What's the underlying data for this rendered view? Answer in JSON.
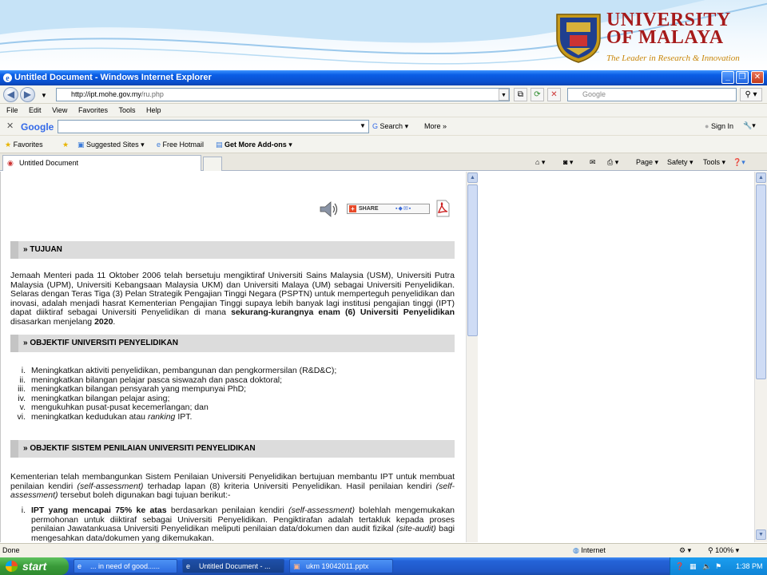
{
  "slide": {
    "logo_line1": "UNIVERSITY",
    "logo_line2": "OF MALAYA",
    "tagline": "The Leader in Research & Innovation"
  },
  "browser": {
    "title": "Untitled Document - Windows Internet Explorer",
    "url_host": "http://ipt.mohe.gov.my",
    "url_path": "/ru.php",
    "search_placeholder": "Google",
    "menu": [
      "File",
      "Edit",
      "View",
      "Favorites",
      "Tools",
      "Help"
    ],
    "google_bar": {
      "logo": "Google",
      "search_label": "Search",
      "more_label": "More »",
      "signin_label": "Sign In"
    },
    "favorites_bar": {
      "favorites": "Favorites",
      "suggested": "Suggested Sites",
      "hotmail": "Free Hotmail",
      "addons": "Get More Add-ons"
    },
    "tab_title": "Untitled Document",
    "command_bar": {
      "page": "Page",
      "safety": "Safety",
      "tools": "Tools"
    },
    "status": {
      "left": "Done",
      "zone": "Internet",
      "zoom": "100%"
    }
  },
  "content": {
    "share_label": "SHARE",
    "sections": {
      "tujuan": "» TUJUAN",
      "objektif_up": "» OBJEKTIF UNIVERSITI PENYELIDIKAN",
      "objektif_sistem": "» OBJEKTIF SISTEM PENILAIAN UNIVERSITI PENYELIDIKAN"
    },
    "tujuan_para_a": "Jemaah Menteri pada 11 Oktober 2006 telah bersetuju mengiktiraf Universiti Sains Malaysia (USM), Universiti Putra Malaysia (UPM), Universiti Kebangsaan Malaysia UKM) dan Universiti Malaya (UM) sebagai Universiti Penyelidikan. Selaras dengan Teras Tiga (3) Pelan Strategik Pengajian Tinggi Negara (PSPTN) untuk memperteguh penyelidikan dan inovasi, adalah menjadi hasrat Kementerian Pengajian Tinggi supaya lebih banyak lagi institusi pengajian tinggi (IPT) dapat diiktiraf sebagai Universiti Penyelidikan di mana ",
    "tujuan_bold_a": "sekurang-kurangnya enam (6) Universiti Penyelidikan",
    "tujuan_para_b": " disasarkan menjelang ",
    "tujuan_bold_b": "2020",
    "tujuan_end": ".",
    "objektif_list": [
      {
        "num": "i.",
        "text": "Meningkatkan aktiviti penyelidikan, pembangunan dan pengkormersilan (R&D&C);"
      },
      {
        "num": "ii.",
        "text": "meningkatkan bilangan pelajar pasca siswazah dan pasca doktoral;"
      },
      {
        "num": "iii.",
        "text": "meningkatkan bilangan pensyarah yang mempunyai PhD;"
      },
      {
        "num": "iv.",
        "text": "meningkatkan bilangan pelajar asing;"
      },
      {
        "num": "v.",
        "text": "mengukuhkan pusat-pusat kecemerlangan; dan"
      },
      {
        "num": "vi.",
        "pre": "meningkatkan kedudukan atau ",
        "italic": "ranking",
        "post": " IPT."
      }
    ],
    "sistem_p1": "Kementerian telah membangunkan Sistem Penilaian Universiti Penyelidikan bertujuan membantu IPT untuk membuat penilaian kendiri ",
    "sistem_i1": "(self-assessment)",
    "sistem_p2": " terhadap lapan (8) kriteria Universiti Penyelidikan. Hasil penilaian kendiri ",
    "sistem_i2": "(self-assessment)",
    "sistem_p3": " tersebut boleh digunakan bagi tujuan berikut:-",
    "item_i_num": "i.",
    "item_i_bold": "IPT yang mencapai 75% ke atas",
    "item_i_t1": " berdasarkan penilaian kendiri ",
    "item_i_i1": "(self-assessment)",
    "item_i_t2": " bolehlah mengemukakan permohonan untuk diiktiraf sebagai Universiti Penyelidikan. Pengiktirafan adalah tertakluk kepada proses penilaian Jawatankuasa Universiti Penyelidikan meliputi penilaian data/dokumen dan audit fizikal ",
    "item_i_i2": "(site-audit)",
    "item_i_t3": " bagi mengesahkan data/dokumen yang dikemukakan."
  },
  "taskbar": {
    "start": "start",
    "tasks": [
      "... in need of good......",
      "Untitled Document - ...",
      "ukm 19042011.pptx"
    ],
    "clock": "1:38 PM"
  },
  "colors": {
    "title_blue": "#0a4fcc",
    "logo_red": "#a61a1a",
    "tag_gold": "#c8870a",
    "start_green": "#3a9b3a"
  }
}
